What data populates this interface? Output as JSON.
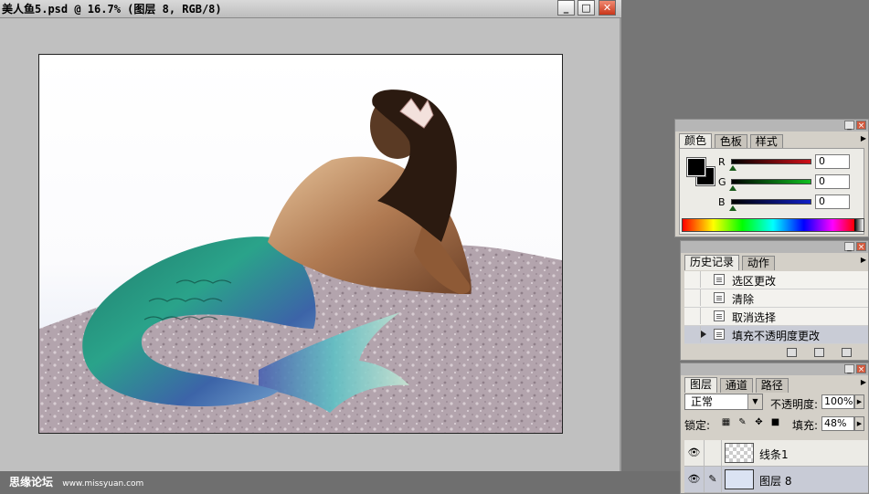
{
  "document": {
    "title": "美人鱼5.psd @ 16.7% (图层 8, RGB/8)",
    "buttons": {
      "minimize": "_",
      "maximize": "□",
      "close": "✕"
    }
  },
  "watermark": {
    "site": "思缘论坛",
    "url": "www.missyuan.com"
  },
  "color_palette": {
    "tabs": [
      "颜色",
      "色板",
      "样式"
    ],
    "active_tab": "颜色",
    "channels": [
      {
        "label": "R",
        "value": "0",
        "color": "#c8141e"
      },
      {
        "label": "G",
        "value": "0",
        "color": "#1a9a2a"
      },
      {
        "label": "B",
        "value": "0",
        "color": "#1a2aa8"
      }
    ],
    "foreground": "#000000",
    "background": "#000000"
  },
  "history_palette": {
    "tabs": [
      "历史记录",
      "动作"
    ],
    "items": [
      {
        "label": "选区更改",
        "selected": false
      },
      {
        "label": "清除",
        "selected": false
      },
      {
        "label": "取消选择",
        "selected": false
      },
      {
        "label": "填充不透明度更改",
        "selected": true
      }
    ]
  },
  "layers_palette": {
    "tabs": [
      "图层",
      "通道",
      "路径"
    ],
    "blend_mode": "正常",
    "opacity_label": "不透明度:",
    "opacity_value": "100%",
    "lock_label": "锁定:",
    "fill_label": "填充:",
    "fill_value": "48%",
    "layers": [
      {
        "name": "线条1",
        "visible": true,
        "selected": false
      },
      {
        "name": "图层 8",
        "visible": true,
        "selected": true
      }
    ]
  }
}
